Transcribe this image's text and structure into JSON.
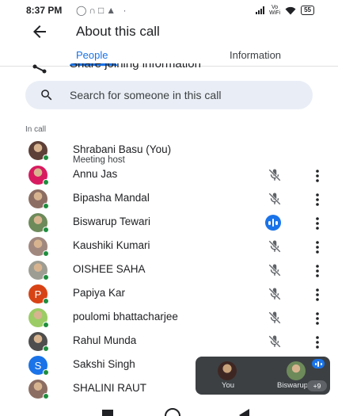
{
  "status_bar": {
    "time": "8:37 PM",
    "volte_label": "Vo WiFi",
    "battery": "55"
  },
  "header": {
    "title": "About this call"
  },
  "tabs": {
    "people": "People",
    "information": "Information"
  },
  "share": {
    "label": "Share joining information"
  },
  "search": {
    "placeholder": "Search for someone in this call"
  },
  "section": {
    "in_call": "In call"
  },
  "participants": [
    {
      "name": "Shrabani Basu (You)",
      "subtitle": "Meeting host",
      "avatar": "photo",
      "color": "#5d4037",
      "state": "host"
    },
    {
      "name": "Annu Jas",
      "avatar": "photo",
      "color": "#d81b60",
      "state": "muted"
    },
    {
      "name": "Bipasha Mandal",
      "avatar": "photo",
      "color": "#8d6e63",
      "state": "muted"
    },
    {
      "name": "Biswarup Tewari",
      "avatar": "photo",
      "color": "#6d8a5a",
      "state": "speaking"
    },
    {
      "name": "Kaushiki Kumari",
      "avatar": "photo",
      "color": "#a1887f",
      "state": "muted"
    },
    {
      "name": "OISHEE SAHA",
      "avatar": "photo",
      "color": "#9e9d94",
      "state": "muted"
    },
    {
      "name": "Papiya Kar",
      "avatar": "letter",
      "letter": "P",
      "color": "#d84315",
      "state": "muted"
    },
    {
      "name": "poulomi bhattacharjee",
      "avatar": "photo",
      "color": "#9ccc65",
      "state": "muted"
    },
    {
      "name": "Rahul Munda",
      "avatar": "photo",
      "color": "#4e4e4e",
      "state": "muted"
    },
    {
      "name": "Sakshi Singh",
      "avatar": "letter",
      "letter": "S",
      "color": "#1a73e8",
      "state": "none"
    },
    {
      "name": "SHALINI RAUT",
      "avatar": "photo",
      "color": "#8d6e63",
      "state": "none"
    }
  ],
  "pip": {
    "you_label": "You",
    "other_label": "Biswarup Tewari",
    "more_count": "+9"
  },
  "colors": {
    "accent": "#1a73e8",
    "online": "#1e8e3e",
    "pip_background": "#3c4043"
  }
}
